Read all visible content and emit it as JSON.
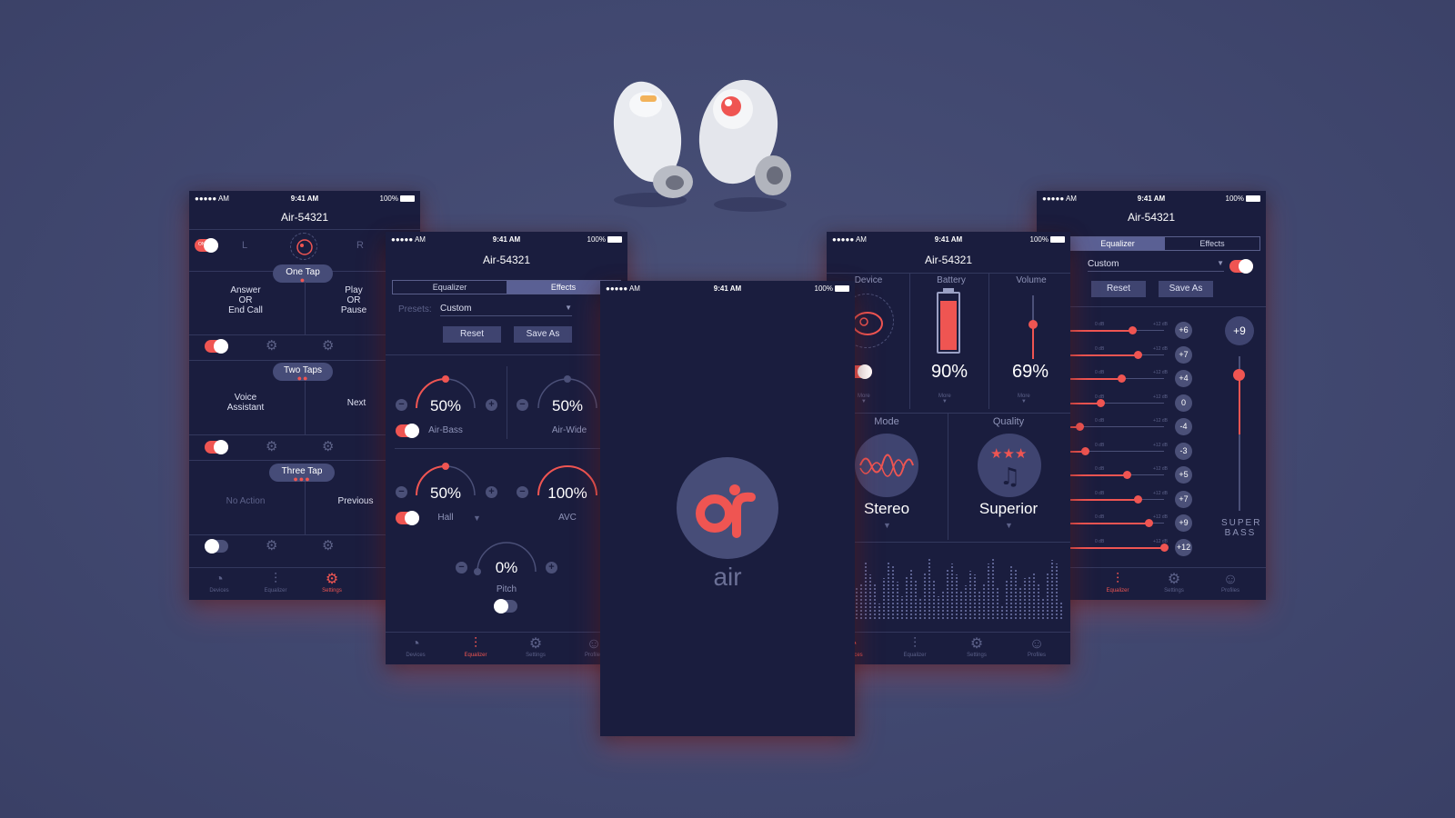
{
  "status": {
    "carrier": "●●●●● AM",
    "time": "9:41 AM",
    "battery": "100%"
  },
  "device_name": "Air-54321",
  "settings_screen": {
    "left": "L",
    "right": "R",
    "sections": [
      {
        "title": "One Tap",
        "dots": "●",
        "left_action": "Answer\nOR\nEnd Call",
        "right_action": "Play\nOR\nPause"
      },
      {
        "title": "Two Taps",
        "dots": "●●",
        "left_action": "Voice\nAssistant",
        "right_action": "Next"
      },
      {
        "title": "Three Tap",
        "dots": "●●●",
        "left_action": "No Action",
        "right_action": "Previous"
      }
    ],
    "tabs": [
      "Devices",
      "Equalizer",
      "Settings"
    ]
  },
  "effects_screen": {
    "segment": [
      "Equalizer",
      "Effects"
    ],
    "presets_label": "Presets:",
    "preset_value": "Custom",
    "reset": "Reset",
    "save_as": "Save As",
    "knobs": [
      {
        "value": "50%",
        "label": "Air-Bass"
      },
      {
        "value": "50%",
        "label": "Air-Wide"
      },
      {
        "value": "50%",
        "label": "Hall"
      },
      {
        "value": "100%",
        "label": "AVC"
      },
      {
        "value": "0%",
        "label": "Pitch"
      }
    ],
    "knob_min": "0",
    "knob_max": "100",
    "tabs": [
      "Devices",
      "Equalizer",
      "Settings",
      "Profiles"
    ]
  },
  "splash": {
    "logo_text": "air"
  },
  "device_screen": {
    "columns": [
      "Device",
      "Battery",
      "Volume"
    ],
    "battery_pct": "90%",
    "battery_level": 0.9,
    "volume_pct": "69%",
    "volume_level": 0.69,
    "more": "More",
    "mode_label": "Mode",
    "mode_value": "Stereo",
    "quality_label": "Quality",
    "quality_value": "Superior",
    "tabs": [
      "Devices",
      "Equalizer",
      "Settings",
      "Profiles"
    ]
  },
  "eq_screen": {
    "segment": [
      "Equalizer",
      "Effects"
    ],
    "preset_value": "Custom",
    "reset": "Reset",
    "save_as": "Save As",
    "band_values": [
      "+6",
      "+7",
      "+4",
      "0",
      "-4",
      "-3",
      "+5",
      "+7",
      "+9",
      "+12"
    ],
    "band_levels": [
      6,
      7,
      4,
      0,
      -4,
      -3,
      5,
      7,
      9,
      12
    ],
    "db_labels": {
      "low": "0 dB",
      "high": "+12 dB"
    },
    "super_bass_value": "+9",
    "super_bass_label": "SUPER BASS",
    "tabs": [
      "Equalizer",
      "Settings",
      "Profiles"
    ]
  },
  "colors": {
    "accent": "#ef5552",
    "screen_bg": "#1a1d3e",
    "page_bg": "#414870"
  }
}
